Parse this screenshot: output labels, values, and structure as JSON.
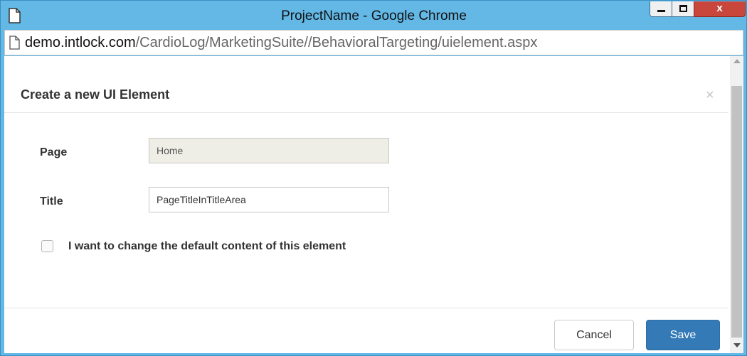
{
  "window": {
    "title": "ProjectName - Google Chrome",
    "close_label": "x",
    "accent": "#63b8e6"
  },
  "address": {
    "host": "demo.intlock.com",
    "path": "/CardioLog/MarketingSuite//BehavioralTargeting/uielement.aspx"
  },
  "dialog": {
    "title": "Create a new UI Element",
    "close_symbol": "×",
    "page_label": "Page",
    "page_value": "Home",
    "title_label": "Title",
    "title_value": "PageTitleInTitleArea",
    "checkbox_label": "I want to change the default content of this element",
    "checkbox_checked": false,
    "cancel_label": "Cancel",
    "save_label": "Save",
    "save_color": "#337ab7"
  },
  "icons": {
    "document": "document-icon",
    "page": "page-icon"
  }
}
